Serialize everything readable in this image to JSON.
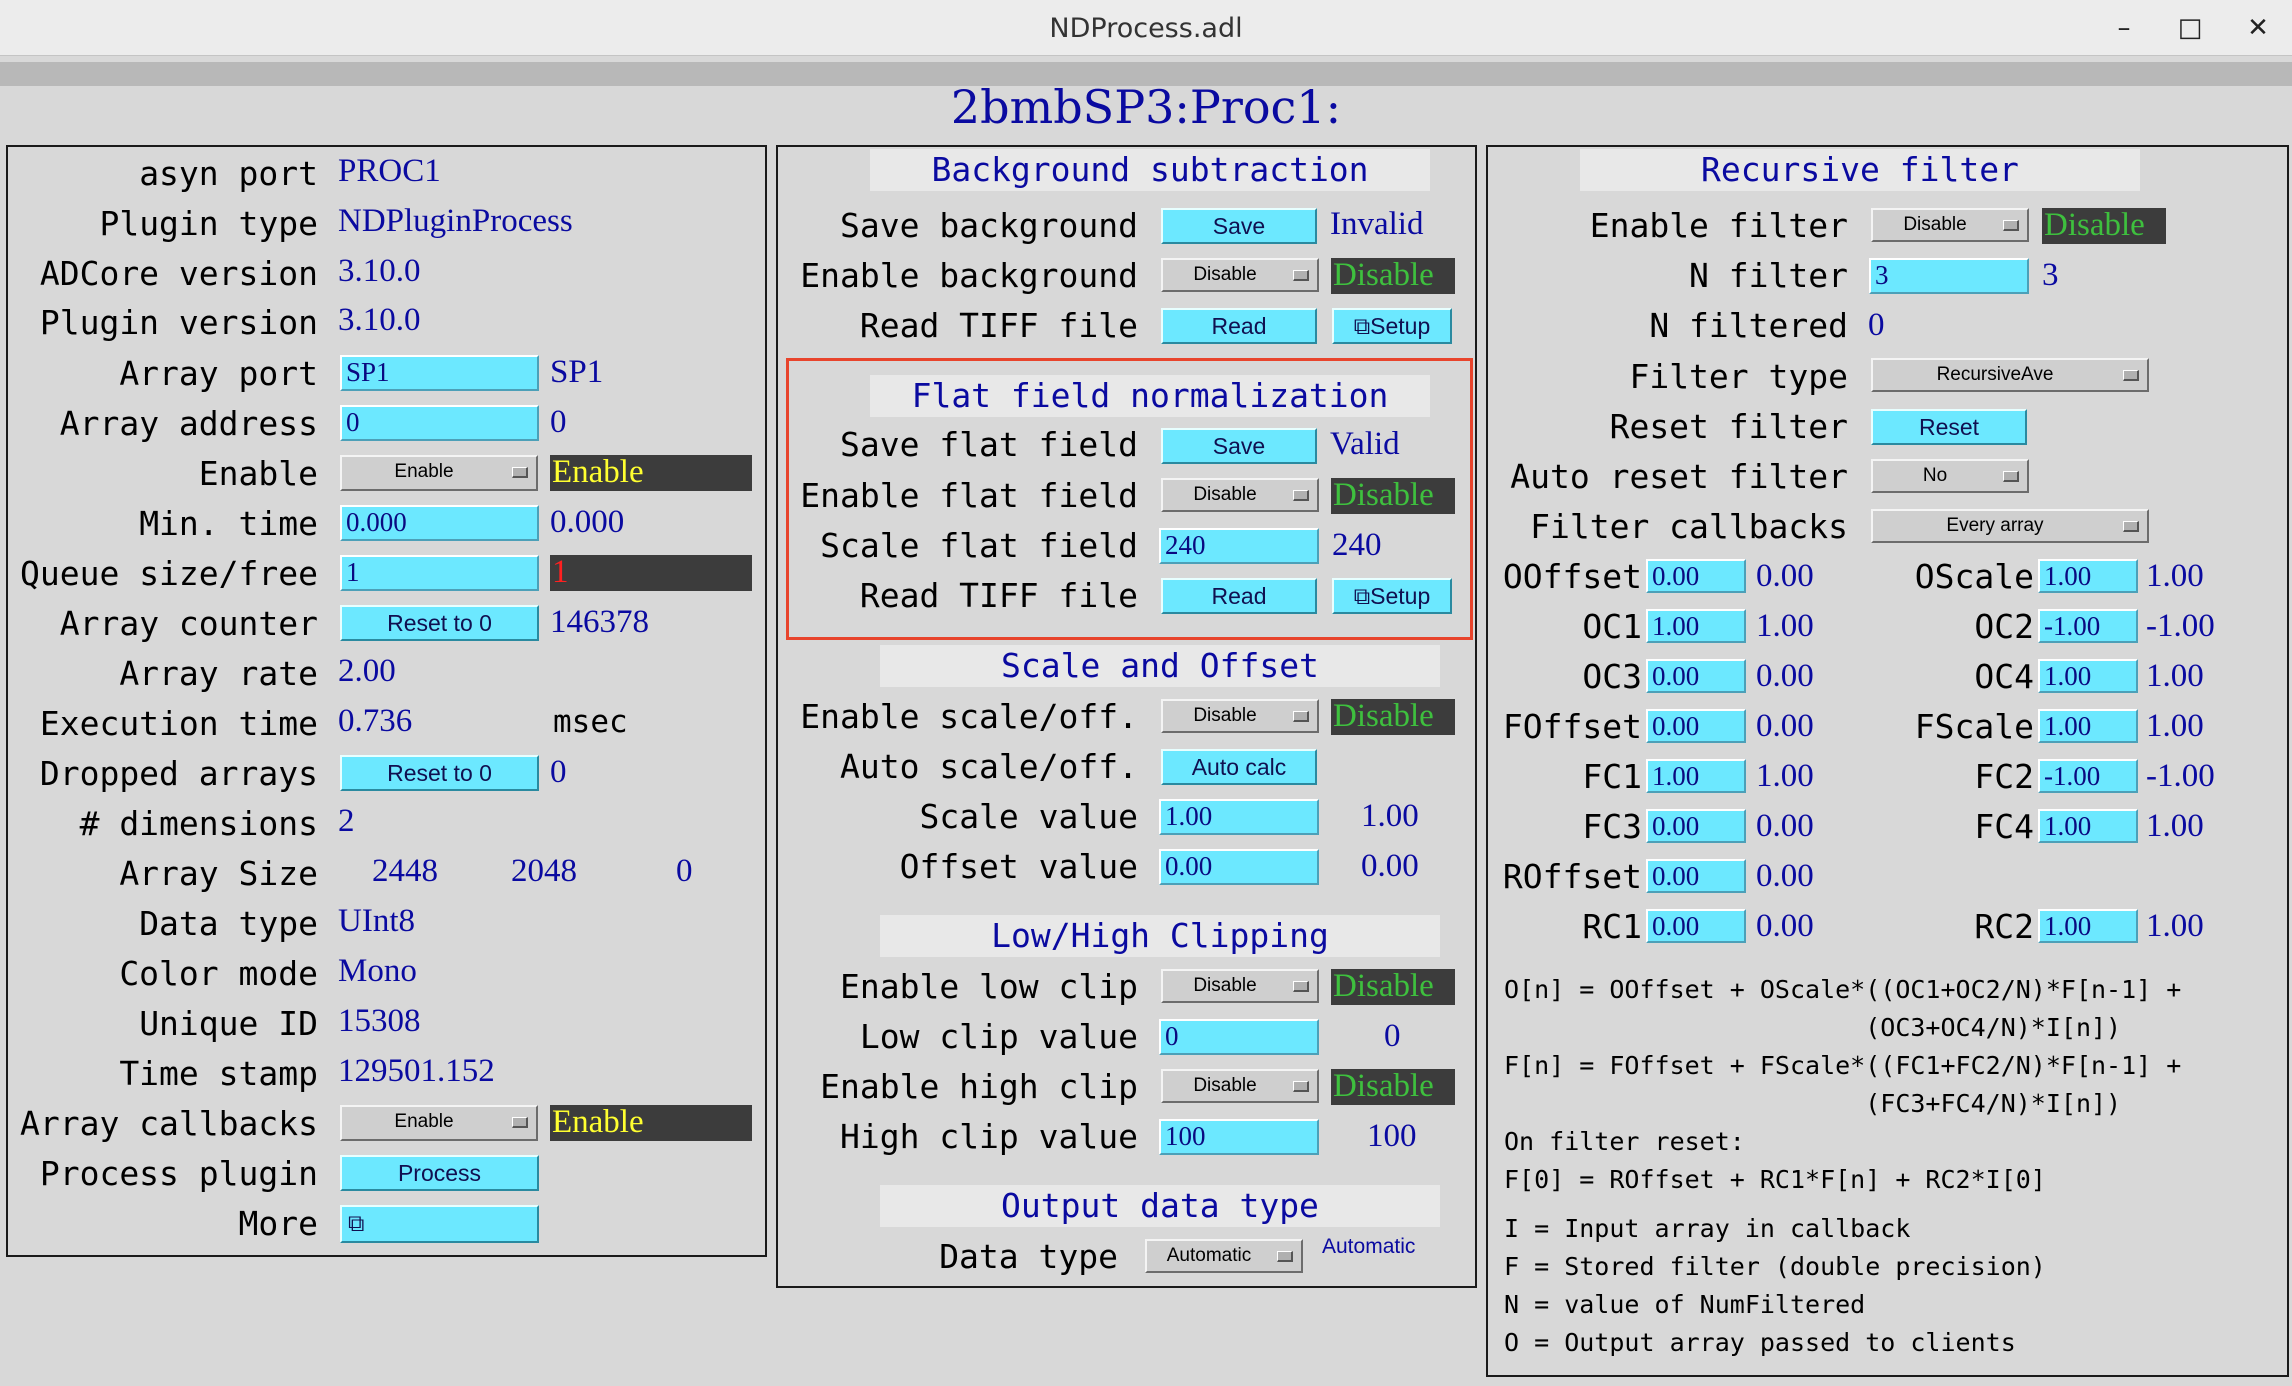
{
  "window": {
    "title": "NDProcess.adl",
    "minimize": "–",
    "maximize": "□",
    "close": "✕"
  },
  "main_title": "2bmbSP3:Proc1:",
  "left": {
    "asyn_port": {
      "label": "asyn port",
      "value": "PROC1"
    },
    "plugin_type": {
      "label": "Plugin type",
      "value": "NDPluginProcess"
    },
    "adcore_version": {
      "label": "ADCore version",
      "value": "3.10.0"
    },
    "plugin_version": {
      "label": "Plugin version",
      "value": "3.10.0"
    },
    "array_port": {
      "label": "Array port",
      "input": "SP1",
      "value": "SP1"
    },
    "array_address": {
      "label": "Array address",
      "input": "0",
      "value": "0"
    },
    "enable": {
      "label": "Enable",
      "menu": "Enable",
      "value": "Enable"
    },
    "min_time": {
      "label": "Min. time",
      "input": "0.000",
      "value": "0.000"
    },
    "queue": {
      "label": "Queue size/free",
      "input": "1",
      "value": "1"
    },
    "array_counter": {
      "label": "Array counter",
      "button": "Reset to 0",
      "value": "146378"
    },
    "array_rate": {
      "label": "Array rate",
      "value": "2.00"
    },
    "execution_time": {
      "label": "Execution time",
      "value": "0.736",
      "unit": "msec"
    },
    "dropped_arrays": {
      "label": "Dropped arrays",
      "button": "Reset to 0",
      "value": "0"
    },
    "dimensions": {
      "label": "# dimensions",
      "value": "2"
    },
    "array_size": {
      "label": "Array Size",
      "x": "2448",
      "y": "2048",
      "z": "0"
    },
    "data_type": {
      "label": "Data type",
      "value": "UInt8"
    },
    "color_mode": {
      "label": "Color mode",
      "value": "Mono"
    },
    "unique_id": {
      "label": "Unique ID",
      "value": "15308"
    },
    "time_stamp": {
      "label": "Time stamp",
      "value": "129501.152"
    },
    "array_callbacks": {
      "label": "Array callbacks",
      "menu": "Enable",
      "value": "Enable"
    },
    "process_plugin": {
      "label": "Process plugin",
      "button": "Process"
    },
    "more": {
      "label": "More",
      "button": "⧉"
    }
  },
  "background": {
    "header": "Background subtraction",
    "save": {
      "label": "Save background",
      "button": "Save",
      "value": "Invalid"
    },
    "enable": {
      "label": "Enable background",
      "menu": "Disable",
      "value": "Disable"
    },
    "read": {
      "label": "Read TIFF file",
      "button": "Read",
      "setup": "⧉Setup"
    }
  },
  "flatfield": {
    "header": "Flat field normalization",
    "save": {
      "label": "Save flat field",
      "button": "Save",
      "value": "Valid"
    },
    "enable": {
      "label": "Enable flat field",
      "menu": "Disable",
      "value": "Disable"
    },
    "scale": {
      "label": "Scale flat field",
      "input": "240",
      "value": "240"
    },
    "read": {
      "label": "Read TIFF file",
      "button": "Read",
      "setup": "⧉Setup"
    }
  },
  "scaleoffset": {
    "header": "Scale and Offset",
    "enable": {
      "label": "Enable scale/off.",
      "menu": "Disable",
      "value": "Disable"
    },
    "auto": {
      "label": "Auto scale/off.",
      "button": "Auto calc"
    },
    "scale": {
      "label": "Scale value",
      "input": "1.00",
      "value": "1.00"
    },
    "offset": {
      "label": "Offset value",
      "input": "0.00",
      "value": "0.00"
    }
  },
  "clipping": {
    "header": "Low/High Clipping",
    "enable_low": {
      "label": "Enable low clip",
      "menu": "Disable",
      "value": "Disable"
    },
    "low": {
      "label": "Low clip value",
      "input": "0",
      "value": "0"
    },
    "enable_high": {
      "label": "Enable high clip",
      "menu": "Disable",
      "value": "Disable"
    },
    "high": {
      "label": "High clip value",
      "input": "100",
      "value": "100"
    }
  },
  "output": {
    "header": "Output data type",
    "dtype": {
      "label": "Data type",
      "menu": "Automatic",
      "value": "Automatic"
    }
  },
  "recursive": {
    "header": "Recursive filter",
    "enable": {
      "label": "Enable filter",
      "menu": "Disable",
      "value": "Disable"
    },
    "n_filter": {
      "label": "N filter",
      "input": "3",
      "value": "3"
    },
    "n_filtered": {
      "label": "N filtered",
      "value": "0"
    },
    "filter_type": {
      "label": "Filter type",
      "menu": "RecursiveAve"
    },
    "reset": {
      "label": "Reset filter",
      "button": "Reset"
    },
    "auto_reset": {
      "label": "Auto reset filter",
      "menu": "No"
    },
    "callbacks": {
      "label": "Filter callbacks",
      "menu": "Every array"
    },
    "ooffset": {
      "label": "OOffset",
      "input": "0.00",
      "value": "0.00"
    },
    "oscale": {
      "label": "OScale",
      "input": "1.00",
      "value": "1.00"
    },
    "oc1": {
      "label": "OC1",
      "input": "1.00",
      "value": "1.00"
    },
    "oc2": {
      "label": "OC2",
      "input": "-1.00",
      "value": "-1.00"
    },
    "oc3": {
      "label": "OC3",
      "input": "0.00",
      "value": "0.00"
    },
    "oc4": {
      "label": "OC4",
      "input": "1.00",
      "value": "1.00"
    },
    "foffset": {
      "label": "FOffset",
      "input": "0.00",
      "value": "0.00"
    },
    "fscale": {
      "label": "FScale",
      "input": "1.00",
      "value": "1.00"
    },
    "fc1": {
      "label": "FC1",
      "input": "1.00",
      "value": "1.00"
    },
    "fc2": {
      "label": "FC2",
      "input": "-1.00",
      "value": "-1.00"
    },
    "fc3": {
      "label": "FC3",
      "input": "0.00",
      "value": "0.00"
    },
    "fc4": {
      "label": "FC4",
      "input": "1.00",
      "value": "1.00"
    },
    "roffset": {
      "label": "ROffset",
      "input": "0.00",
      "value": "0.00"
    },
    "rc1": {
      "label": "RC1",
      "input": "0.00",
      "value": "0.00"
    },
    "rc2": {
      "label": "RC2",
      "input": "1.00",
      "value": "1.00"
    },
    "formulas": [
      "O[n] = OOffset + OScale*((OC1+OC2/N)*F[n-1] +",
      "                        (OC3+OC4/N)*I[n])",
      "F[n] = FOffset + FScale*((FC1+FC2/N)*F[n-1] +",
      "                        (FC3+FC4/N)*I[n])",
      "On filter reset:",
      "F[0] = ROffset + RC1*F[n] + RC2*I[0]",
      "I = Input array in callback",
      "F = Stored filter (double precision)",
      "N = value of NumFiltered",
      "O = Output array passed to clients"
    ]
  },
  "colors": {
    "monitor": "#0a0aa0",
    "input_bg": "#6ce8ff",
    "alarm_green": "#3ec03e",
    "alarm_yellow": "#ffff30",
    "alarm_red": "#ff2020",
    "highlight": "#e8442c"
  }
}
